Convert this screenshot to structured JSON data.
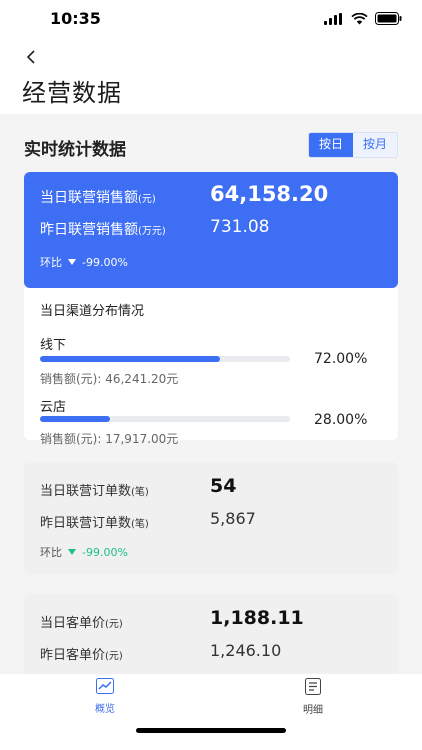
{
  "status": {
    "time": "10:35"
  },
  "header": {
    "title": "经营数据"
  },
  "section": {
    "title": "实时统计数据",
    "segment": [
      "按日",
      "按月"
    ],
    "segment_selected": 0
  },
  "sales": {
    "today_label": "当日联营销售额",
    "today_unit": "(元)",
    "today_value": "64,158.20",
    "yesterday_label": "昨日联营销售额",
    "yesterday_unit": "(万元)",
    "yesterday_value": "731.08",
    "change_label": "环比",
    "change_value": "-99.00%"
  },
  "distribution": {
    "title": "当日渠道分布情况",
    "channels": [
      {
        "name": "线下",
        "percent": "72.00%",
        "share": 72,
        "amount": "销售额(元): 46,241.20元"
      },
      {
        "name": "云店",
        "percent": "28.00%",
        "share": 28,
        "amount": "销售额(元): 17,917.00元"
      }
    ]
  },
  "orders": {
    "today_label": "当日联营订单数",
    "today_unit": "(笔)",
    "today_value": "54",
    "yesterday_label": "昨日联营订单数",
    "yesterday_unit": "(笔)",
    "yesterday_value": "5,867",
    "change_label": "环比",
    "change_value": "-99.00%"
  },
  "unit_price": {
    "today_label": "当日客单价",
    "today_unit": "(元)",
    "today_value": "1,188.11",
    "yesterday_label": "昨日客单价",
    "yesterday_unit": "(元)",
    "yesterday_value": "1,246.10"
  },
  "tabs": [
    {
      "label": "概览",
      "icon": "chart-icon",
      "active": true
    },
    {
      "label": "明细",
      "icon": "document-icon",
      "active": false
    }
  ],
  "colors": {
    "accent": "#3d6ef3",
    "down_green": "#1fbf86",
    "background": "#f4f4f5"
  }
}
